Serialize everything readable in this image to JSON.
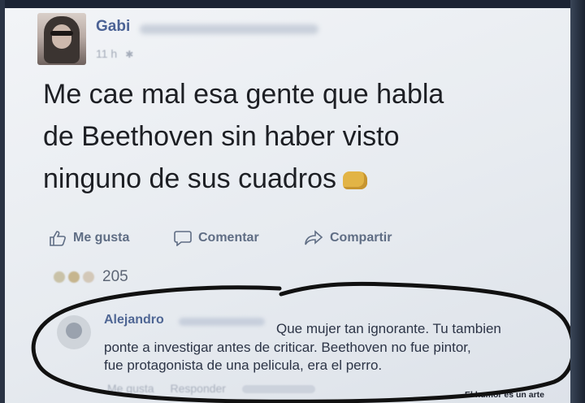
{
  "post": {
    "author": "Gabi",
    "time": "11 h",
    "text_lines": [
      "Me cae mal esa gente que habla",
      "de Beethoven sin haber visto",
      "ninguno de sus cuadros"
    ],
    "emoji": "fist-icon"
  },
  "actions": {
    "like": "Me gusta",
    "comment": "Comentar",
    "share": "Compartir"
  },
  "reactions": {
    "count": "205"
  },
  "comment": {
    "author": "Alejandro",
    "lines": [
      "Que mujer tan ignorante. Tu tambien",
      "ponte a investigar antes de criticar. Beethoven no fue pintor,",
      "fue protagonista de una pelicula, era el perro."
    ],
    "like_label": "Me gusta",
    "reply_label": "Responder"
  },
  "watermark": "El humor es un arte",
  "colors": {
    "link_blue": "#4b6295",
    "action_gray": "#5f6d84",
    "ink_circle": "#111111"
  }
}
